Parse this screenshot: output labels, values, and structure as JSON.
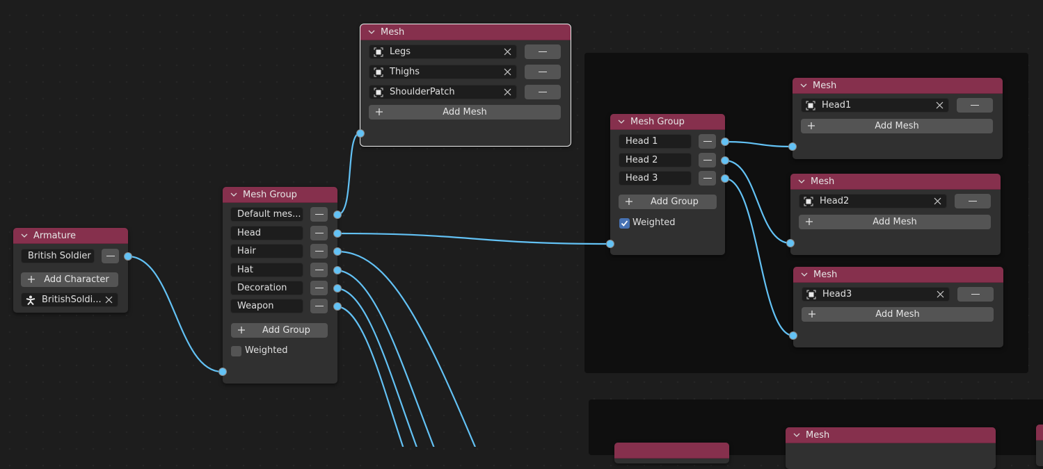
{
  "colors": {
    "background": "#1d1d1d",
    "frame": "#0f0f0f",
    "node_body": "#303030",
    "node_header": "#86304d",
    "field": "#1d1d1d",
    "button": "#545454",
    "wire": "#63c2f5",
    "checkbox_on": "#4772b3"
  },
  "icons": {
    "collapse": "chevron-down-icon",
    "remove": "minus-icon",
    "add": "plus-icon",
    "clear": "x-icon",
    "object": "mesh-object-icon",
    "armature": "armature-figure-icon"
  },
  "armature_node": {
    "title": "Armature",
    "character_name": "British Soldier",
    "add_character_label": "Add Character",
    "armature_object": "BritishSoldi..."
  },
  "mesh_group_node_1": {
    "title": "Mesh Group",
    "groups": [
      "Default mes...",
      "Head",
      "Hair",
      "Hat",
      "Decoration",
      "Weapon"
    ],
    "add_group_label": "Add Group",
    "weighted_label": "Weighted",
    "weighted": false
  },
  "mesh_node_top": {
    "title": "Mesh",
    "meshes": [
      "Legs",
      "Thighs",
      "ShoulderPatch"
    ],
    "add_mesh_label": "Add Mesh"
  },
  "mesh_group_node_2": {
    "title": "Mesh Group",
    "groups": [
      "Head 1",
      "Head 2",
      "Head 3"
    ],
    "add_group_label": "Add Group",
    "weighted_label": "Weighted",
    "weighted": true
  },
  "mesh_node_head1": {
    "title": "Mesh",
    "meshes": [
      "Head1"
    ],
    "add_mesh_label": "Add Mesh"
  },
  "mesh_node_head2": {
    "title": "Mesh",
    "meshes": [
      "Head2"
    ],
    "add_mesh_label": "Add Mesh"
  },
  "mesh_node_head3": {
    "title": "Mesh",
    "meshes": [
      "Head3"
    ],
    "add_mesh_label": "Add Mesh"
  },
  "mesh_node_bottom": {
    "title": "Mesh"
  }
}
